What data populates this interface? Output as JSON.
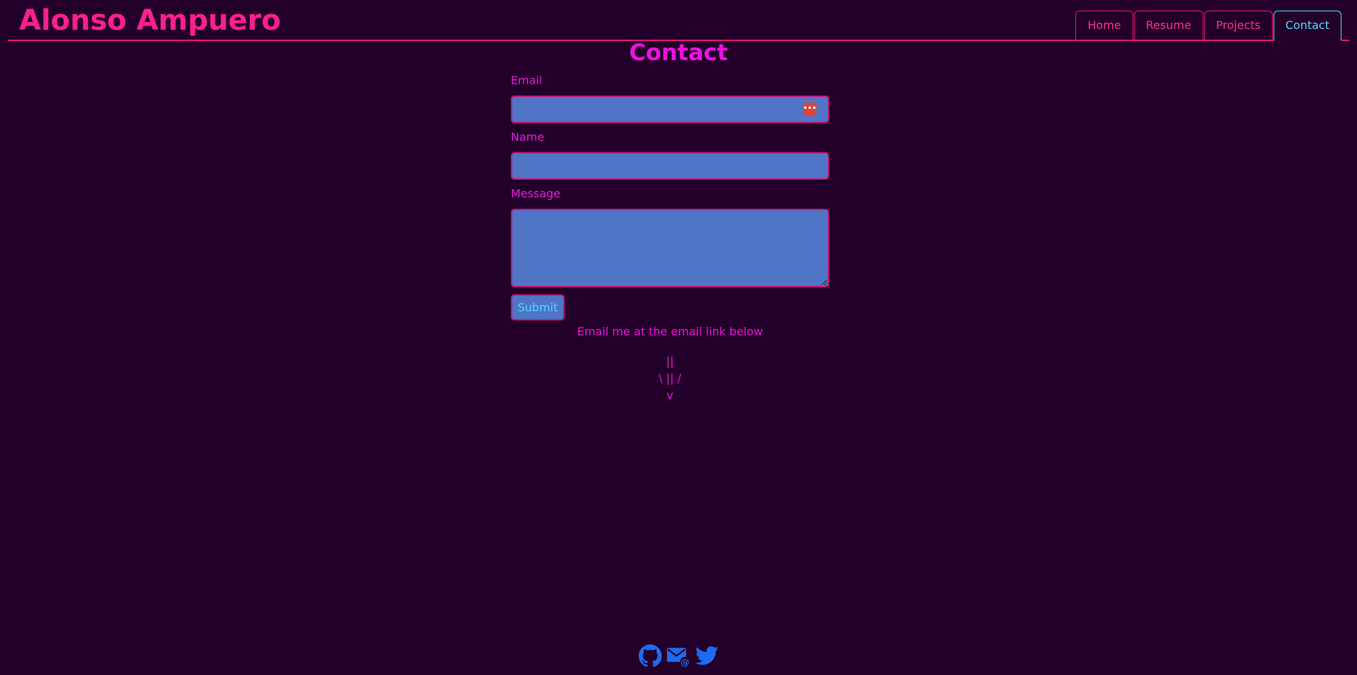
{
  "header": {
    "site_title": "Alonso Ampuero"
  },
  "nav": {
    "tabs": [
      {
        "label": "Home",
        "active": false
      },
      {
        "label": "Resume",
        "active": false
      },
      {
        "label": "Projects",
        "active": false
      },
      {
        "label": "Contact",
        "active": true
      }
    ]
  },
  "main": {
    "page_title": "Contact",
    "form": {
      "email_label": "Email",
      "email_value": "",
      "name_label": "Name",
      "name_value": "",
      "message_label": "Message",
      "message_value": "",
      "submit_label": "Submit"
    },
    "email_note": "Email me at the email link below",
    "arrow_lines": [
      "||",
      "\\ || /",
      "v"
    ]
  },
  "footer": {
    "icons": [
      "github-icon",
      "email-icon",
      "twitter-icon"
    ]
  },
  "colors": {
    "background": "#23002a",
    "accent_pink": "#ff1f8e",
    "magenta": "#ee10e0",
    "cyan": "#4fd6ff",
    "input_fill": "#5075c6",
    "icon_blue": "#1d6bf0"
  }
}
